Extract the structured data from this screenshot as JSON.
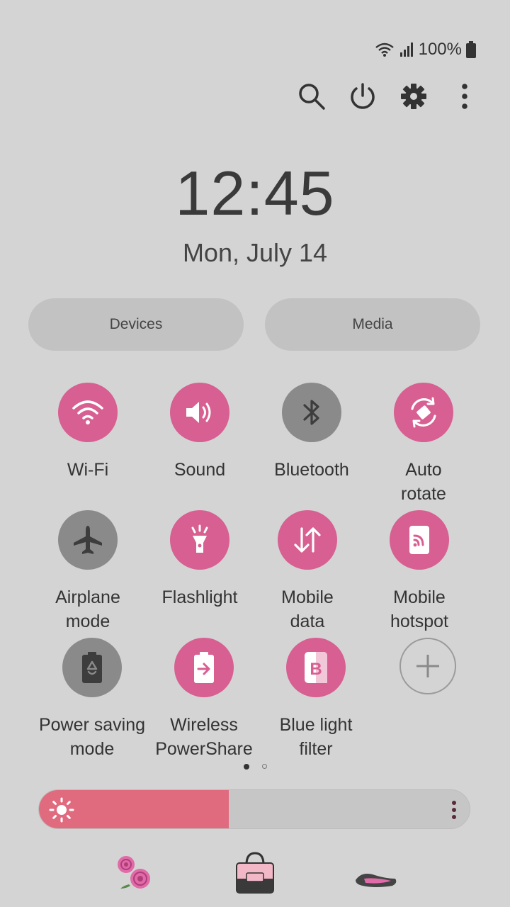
{
  "status": {
    "battery_text": "100%"
  },
  "actions": [
    {
      "name": "search",
      "icon": "search-icon"
    },
    {
      "name": "power",
      "icon": "power-icon"
    },
    {
      "name": "settings",
      "icon": "gear-icon"
    },
    {
      "name": "more",
      "icon": "more-vertical-icon"
    }
  ],
  "clock": {
    "time": "12:45",
    "date": "Mon, July 14"
  },
  "pills": {
    "devices": "Devices",
    "media": "Media"
  },
  "tiles": [
    {
      "label": "Wi-Fi",
      "state": "on",
      "icon": "wifi-icon"
    },
    {
      "label": "Sound",
      "state": "on",
      "icon": "sound-icon"
    },
    {
      "label": "Bluetooth",
      "state": "off",
      "icon": "bluetooth-icon"
    },
    {
      "label": "Auto\nrotate",
      "state": "on",
      "icon": "auto-rotate-icon"
    },
    {
      "label": "Airplane\nmode",
      "state": "off",
      "icon": "airplane-icon"
    },
    {
      "label": "Flashlight",
      "state": "on",
      "icon": "flashlight-icon"
    },
    {
      "label": "Mobile\ndata",
      "state": "on",
      "icon": "mobile-data-icon"
    },
    {
      "label": "Mobile\nhotspot",
      "state": "on",
      "icon": "hotspot-icon"
    },
    {
      "label": "Power saving\nmode",
      "state": "off",
      "icon": "power-saving-icon"
    },
    {
      "label": "Wireless\nPowerShare",
      "state": "on",
      "icon": "powershare-icon"
    },
    {
      "label": "Blue light\nfilter",
      "state": "on",
      "icon": "blue-light-filter-icon"
    },
    {
      "label": "",
      "state": "add",
      "icon": "add-icon"
    }
  ],
  "pager": {
    "pages": 2,
    "current": 1
  },
  "brightness": {
    "level": 0.44
  },
  "colors": {
    "accent": "#d75f91",
    "off": "#8a8a8a",
    "brightness": "#e06b7f",
    "background": "#d4d4d4"
  },
  "dock": [
    {
      "name": "roses",
      "icon": "roses-icon"
    },
    {
      "name": "handbag",
      "icon": "handbag-icon"
    },
    {
      "name": "shoe",
      "icon": "shoe-icon"
    }
  ]
}
